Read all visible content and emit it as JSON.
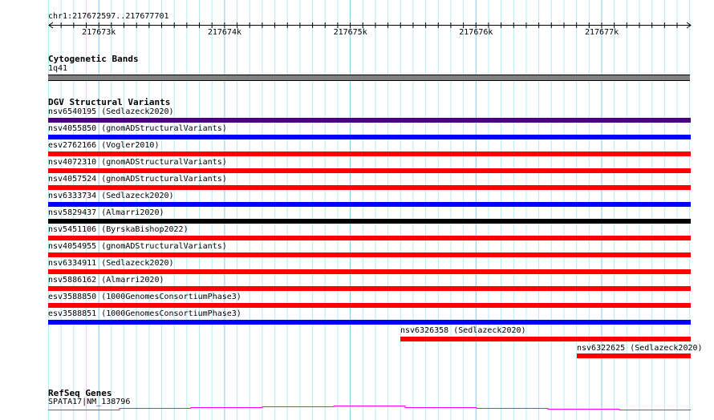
{
  "ruler": {
    "location": "chr1:217672597..217677701",
    "ticks": [
      "217673k",
      "217674k",
      "217675k",
      "217676k",
      "217677k"
    ]
  },
  "cytoband": {
    "title": "Cytogenetic Bands",
    "band": "1q41",
    "color": "#808080"
  },
  "dgv": {
    "title": "DGV Structural Variants",
    "rows": [
      {
        "label": "nsv6540195 (Sedlazeck2020)",
        "color": "#4b0082"
      },
      {
        "label": "nsv4055850 (gnomADStructuralVariants)",
        "color": "#0000ff"
      },
      {
        "label": "esv2762166 (Vogler2010)",
        "color": "#ff0000"
      },
      {
        "label": "nsv4072310 (gnomADStructuralVariants)",
        "color": "#ff0000"
      },
      {
        "label": "nsv4057524 (gnomADStructuralVariants)",
        "color": "#ff0000"
      },
      {
        "label": "nsv6333734 (Sedlazeck2020)",
        "color": "#0000ff"
      },
      {
        "label": "nsv5829437 (Almarri2020)",
        "color": "#000000"
      },
      {
        "label": "nsv5451106 (ByrskaBishop2022)",
        "color": "#ff0000"
      },
      {
        "label": "nsv4054955 (gnomADStructuralVariants)",
        "color": "#ff0000"
      },
      {
        "label": "nsv6334911 (Sedlazeck2020)",
        "color": "#ff0000"
      },
      {
        "label": "nsv5886162 (Almarri2020)",
        "color": "#ff0000"
      },
      {
        "label": "esv3588850 (1000GenomesConsortiumPhase3)",
        "color": "#ff0000"
      },
      {
        "label": "esv3588851 (1000GenomesConsortiumPhase3)",
        "color": "#0000ff"
      }
    ],
    "partial": [
      {
        "label": "nsv6326358 (Sedlazeck2020)",
        "color": "#ff0000"
      },
      {
        "label": "nsv6322625 (Sedlazeck2020)",
        "color": "#ff0000"
      }
    ]
  },
  "refseq": {
    "title": "RefSeq Genes",
    "gene": "SPATA17|NM_138796",
    "color": "#ff00ff"
  }
}
